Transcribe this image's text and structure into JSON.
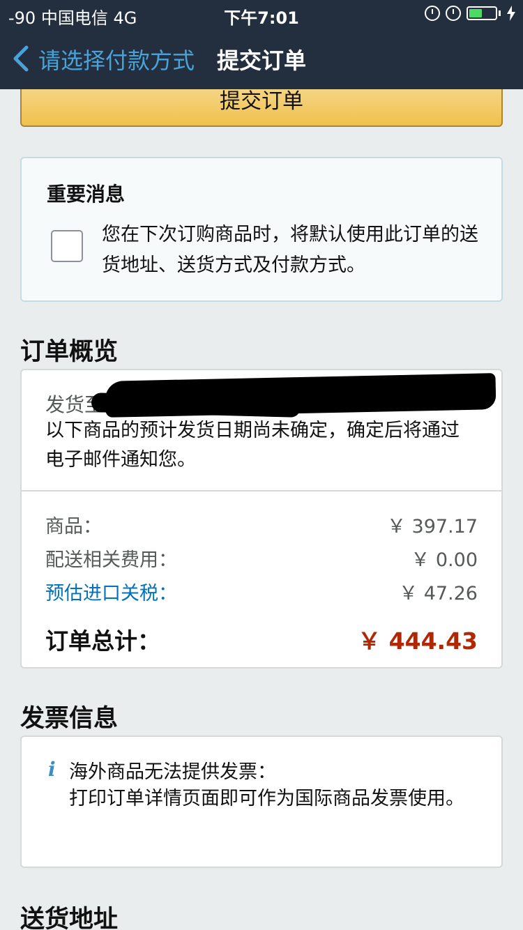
{
  "status_bar": {
    "signal": "-90 中国电信   4G",
    "time": "下午7:01"
  },
  "nav": {
    "back_label": "请选择付款方式",
    "title": "提交订单"
  },
  "submit_button_label": "提交订单",
  "notice": {
    "title": "重要消息",
    "checkbox_checked": false,
    "text": "您在下次订购商品时，将默认使用此订单的送货地址、送货方式及付款方式。"
  },
  "order_overview": {
    "heading": "订单概览",
    "ship_to_label": "发货至",
    "eta_text": "以下商品的预计发货日期尚未确定，确定后将通过电子邮件通知您。",
    "items_label": "商品：",
    "items_value": "￥ 397.17",
    "shipping_label": "配送相关费用：",
    "shipping_value": "￥ 0.00",
    "tax_label": "预估进口关税：",
    "tax_value": "￥ 47.26",
    "total_label": "订单总计：",
    "total_value": "￥ 444.43"
  },
  "invoice": {
    "heading": "发票信息",
    "icon": "i",
    "title": "海外商品无法提供发票：",
    "text": "打印订单详情页面即可作为国际商品发票使用。"
  },
  "shipping_address_heading": "送货地址",
  "colors": {
    "nav_bg": "#232f3e",
    "back_link": "#4aa3d8",
    "button_yellow": "#f0c14b",
    "total_red": "#b12704",
    "link_blue": "#0073bb"
  }
}
